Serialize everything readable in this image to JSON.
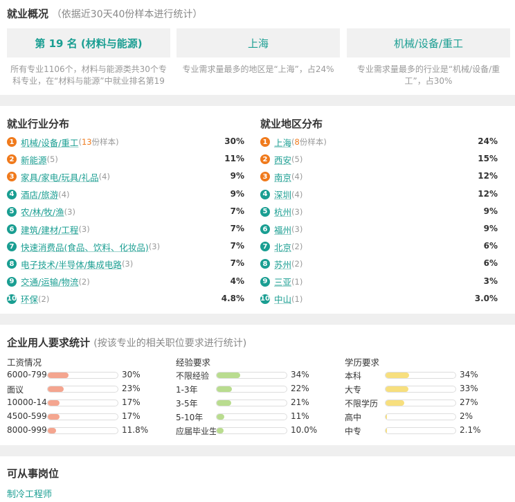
{
  "overview": {
    "title": "就业概况",
    "subtitle": "（依据近30天40份样本进行统计）",
    "boxes": [
      {
        "value": "第 19 名 (材料与能源)",
        "desc": "所有专业1106个，材料与能源类共30个专科专业，在“材料与能源”中就业排名第19"
      },
      {
        "value": "上海",
        "desc": "专业需求量最多的地区是“上海”，占24%"
      },
      {
        "value": "机械/设备/重工",
        "desc": "专业需求量最多的行业是“机械/设备/重工”，占30%"
      }
    ]
  },
  "industry": {
    "title": "就业行业分布",
    "items": [
      {
        "rank": "1",
        "name": "机械/设备/重工",
        "count_pre": "(",
        "count_num": "13",
        "count_post": "份样本)",
        "pct": "30%"
      },
      {
        "rank": "2",
        "name": "新能源",
        "count": "(5)",
        "pct": "11%"
      },
      {
        "rank": "3",
        "name": "家具/家电/玩具/礼品",
        "count": "(4)",
        "pct": "9%"
      },
      {
        "rank": "4",
        "name": "酒店/旅游",
        "count": "(4)",
        "pct": "9%"
      },
      {
        "rank": "5",
        "name": "农/林/牧/渔",
        "count": "(3)",
        "pct": "7%"
      },
      {
        "rank": "6",
        "name": "建筑/建材/工程",
        "count": "(3)",
        "pct": "7%"
      },
      {
        "rank": "7",
        "name": "快速消费品(食品、饮料、化妆品)",
        "count": "(3)",
        "pct": "7%"
      },
      {
        "rank": "8",
        "name": "电子技术/半导体/集成电路",
        "count": "(3)",
        "pct": "7%"
      },
      {
        "rank": "9",
        "name": "交通/运输/物流",
        "count": "(2)",
        "pct": "4%"
      },
      {
        "rank": "10",
        "name": "环保",
        "count": "(2)",
        "pct": "4.8%"
      }
    ]
  },
  "region": {
    "title": "就业地区分布",
    "items": [
      {
        "rank": "1",
        "name": "上海",
        "count_pre": "(",
        "count_num": "8",
        "count_post": "份样本)",
        "pct": "24%"
      },
      {
        "rank": "2",
        "name": "西安",
        "count": "(5)",
        "pct": "15%"
      },
      {
        "rank": "3",
        "name": "南京",
        "count": "(4)",
        "pct": "12%"
      },
      {
        "rank": "4",
        "name": "深圳",
        "count": "(4)",
        "pct": "12%"
      },
      {
        "rank": "5",
        "name": "杭州",
        "count": "(3)",
        "pct": "9%"
      },
      {
        "rank": "6",
        "name": "福州",
        "count": "(3)",
        "pct": "9%"
      },
      {
        "rank": "7",
        "name": "北京",
        "count": "(2)",
        "pct": "6%"
      },
      {
        "rank": "8",
        "name": "苏州",
        "count": "(2)",
        "pct": "6%"
      },
      {
        "rank": "9",
        "name": "三亚",
        "count": "(1)",
        "pct": "3%"
      },
      {
        "rank": "10",
        "name": "中山",
        "count": "(1)",
        "pct": "3.0%"
      }
    ]
  },
  "requirements": {
    "title": "企业用人要求统计",
    "subtitle": "(按该专业的相关职位要求进行统计)",
    "salary": {
      "title": "工资情况",
      "color": "#f4a58f",
      "rows": [
        {
          "label": "6000-7999",
          "value": "30%",
          "level": 30
        },
        {
          "label": "面议",
          "value": "23%",
          "level": 23
        },
        {
          "label": "10000-14999",
          "value": "17%",
          "level": 17
        },
        {
          "label": "4500-5999",
          "value": "17%",
          "level": 17
        },
        {
          "label": "8000-9999",
          "value": "11.8%",
          "level": 11.8
        }
      ]
    },
    "experience": {
      "title": "经验要求",
      "color": "#b9dc8f",
      "rows": [
        {
          "label": "不限经验",
          "value": "34%",
          "level": 34
        },
        {
          "label": "1-3年",
          "value": "22%",
          "level": 22
        },
        {
          "label": "3-5年",
          "value": "21%",
          "level": 21
        },
        {
          "label": "5-10年",
          "value": "11%",
          "level": 11
        },
        {
          "label": "应届毕业生",
          "value": "10.0%",
          "level": 10
        }
      ]
    },
    "education": {
      "title": "学历要求",
      "color": "#f7df7e",
      "rows": [
        {
          "label": "本科",
          "value": "34%",
          "level": 34
        },
        {
          "label": "大专",
          "value": "33%",
          "level": 33
        },
        {
          "label": "不限学历",
          "value": "27%",
          "level": 27
        },
        {
          "label": "高中",
          "value": "2%",
          "level": 2
        },
        {
          "label": "中专",
          "value": "2.1%",
          "level": 2.1
        }
      ]
    }
  },
  "positions": {
    "title": "可从事岗位",
    "items": [
      "制冷工程师"
    ]
  }
}
